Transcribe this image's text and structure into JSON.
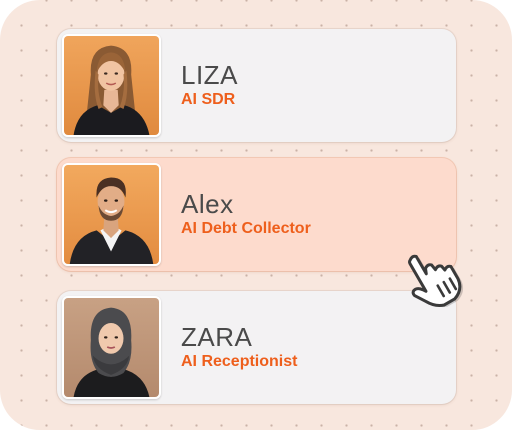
{
  "agents": [
    {
      "name": "LIZA",
      "role": "AI SDR",
      "active": false
    },
    {
      "name": "Alex",
      "role": "AI Debt Collector",
      "active": true
    },
    {
      "name": "ZARA",
      "role": "AI Receptionist",
      "active": false
    }
  ],
  "colors": {
    "panel_background": "#f8e7de",
    "card_background": "#f3f2f3",
    "active_card_background": "#fddbcd",
    "name_text": "#4a4a4a",
    "role_accent": "#ee5f1c"
  },
  "icons": {
    "cursor": "hand-pointer-icon"
  }
}
